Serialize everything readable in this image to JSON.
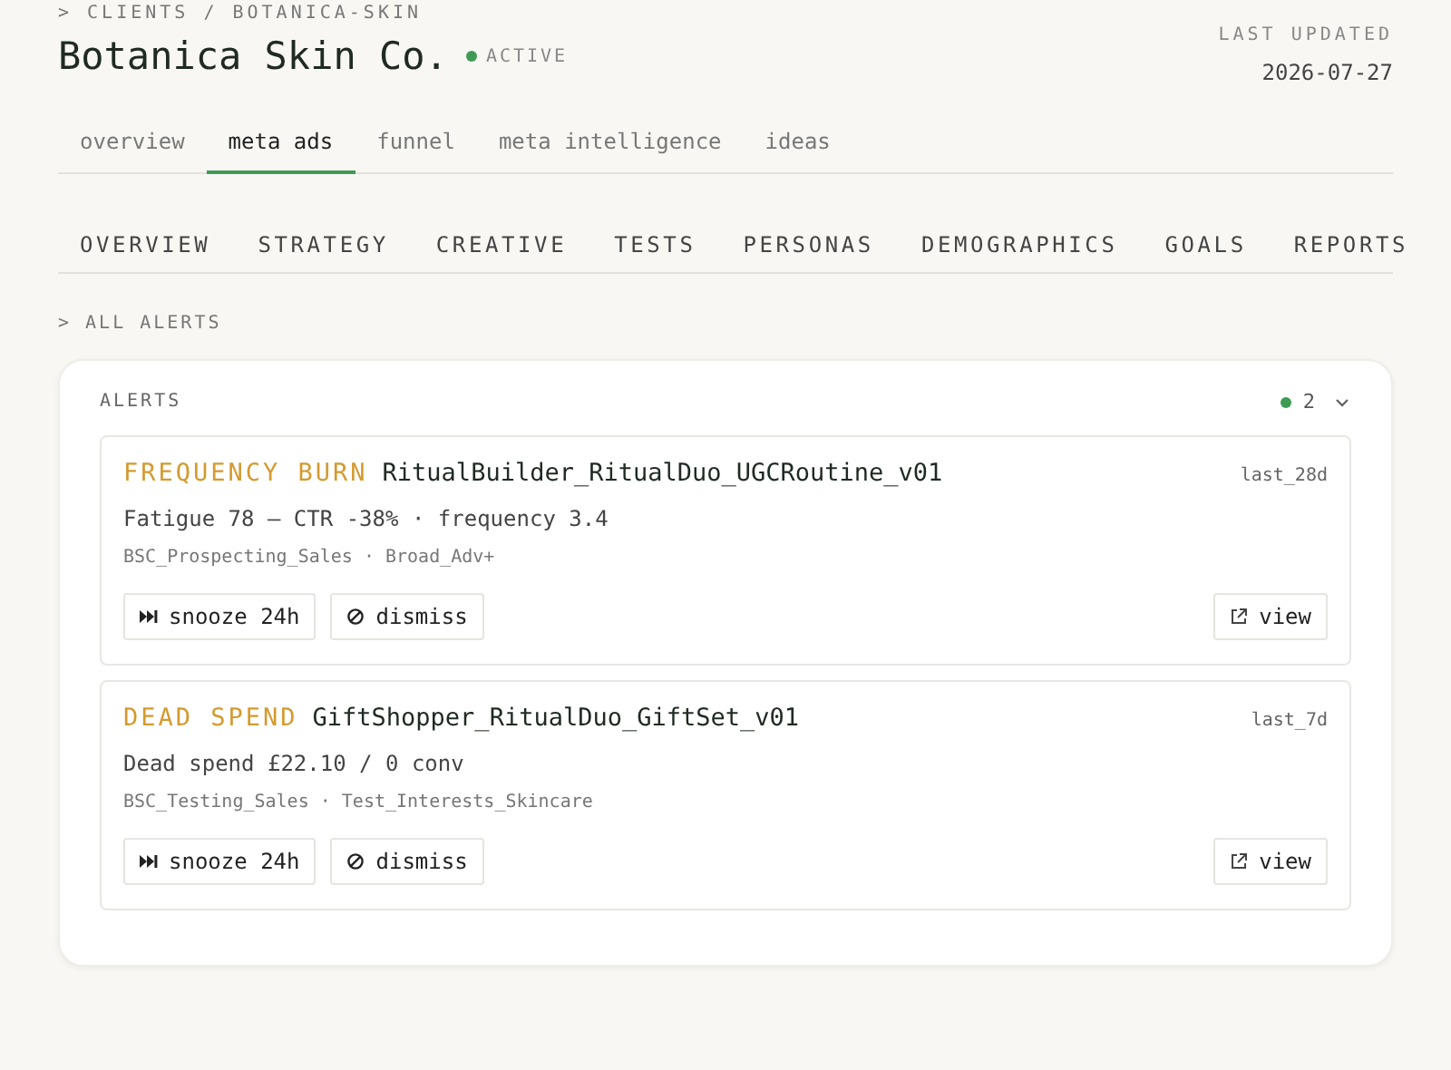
{
  "breadcrumb": "> CLIENTS / BOTANICA-SKIN",
  "client": {
    "name": "Botanica Skin Co.",
    "status": "ACTIVE",
    "active": true
  },
  "last_updated": {
    "label": "LAST UPDATED",
    "value": "2026-07-27"
  },
  "tabs": [
    {
      "label": "overview",
      "selected": false
    },
    {
      "label": "meta ads",
      "selected": true
    },
    {
      "label": "funnel",
      "selected": false
    },
    {
      "label": "meta intelligence",
      "selected": false
    },
    {
      "label": "ideas",
      "selected": false
    }
  ],
  "section_tabs": [
    "OVERVIEW",
    "STRATEGY",
    "CREATIVE",
    "TESTS",
    "PERSONAS",
    "DEMOGRAPHICS",
    "GOALS",
    "REPORTS"
  ],
  "sub_breadcrumb": "> ALL ALERTS",
  "alerts_panel": {
    "title": "ALERTS",
    "count": "2",
    "expanded": true,
    "alerts": [
      {
        "type": "FREQUENCY BURN",
        "ad": "RitualBuilder_RitualDuo_UGCRoutine_v01",
        "window": "last_28d",
        "detail": "Fatigue 78 — CTR -38% · frequency 3.4",
        "context": "BSC_Prospecting_Sales · Broad_Adv+",
        "actions": [
          "snooze 24h",
          "dismiss"
        ],
        "view": "view"
      },
      {
        "type": "DEAD SPEND",
        "ad": "GiftShopper_RitualDuo_GiftSet_v01",
        "window": "last_7d",
        "detail": "Dead spend £22.10 / 0 conv",
        "context": "BSC_Testing_Sales · Test_Interests_Skincare",
        "actions": [
          "snooze 24h",
          "dismiss"
        ],
        "view": "view"
      }
    ]
  }
}
